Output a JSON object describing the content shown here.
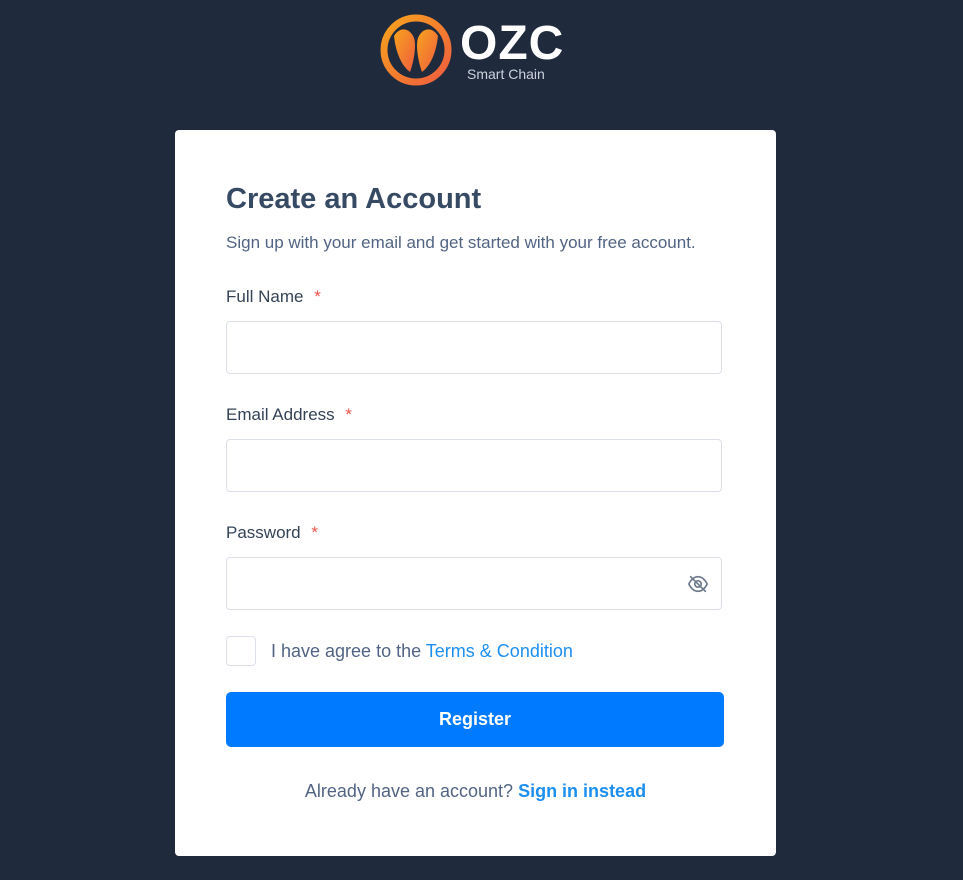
{
  "brand": {
    "name": "OZC",
    "tagline": "Smart Chain",
    "colors": {
      "mark_start": "#f7941d",
      "mark_end": "#ef5d3f",
      "background": "#1f2a3c"
    }
  },
  "form": {
    "title": "Create an Account",
    "subtitle": "Sign up with your email and get started with your free account.",
    "required_marker": "*",
    "fields": [
      {
        "label": "Full Name",
        "value": "",
        "placeholder": ""
      },
      {
        "label": "Email Address",
        "value": "",
        "placeholder": ""
      },
      {
        "label": "Password",
        "value": "",
        "placeholder": "",
        "toggle_icon": "eye-off-icon"
      }
    ],
    "agreement": {
      "text": "I have agree to the ",
      "link": "Terms & Condition",
      "checked": false
    },
    "submit_label": "Register",
    "footer": {
      "text": "Already have an account? ",
      "link": "Sign in instead"
    }
  },
  "colors": {
    "primary": "#007bff",
    "link": "#1d8ff0",
    "required": "#e85347",
    "heading": "#364a63"
  }
}
